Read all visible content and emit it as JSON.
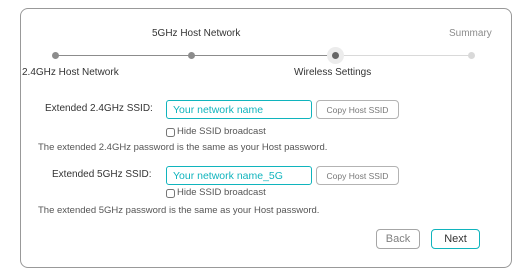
{
  "steps": [
    {
      "label": "2.4GHz Host Network",
      "state": "done"
    },
    {
      "label": "5GHz Host Network",
      "state": "done"
    },
    {
      "label": "Wireless Settings",
      "state": "current"
    },
    {
      "label": "Summary",
      "state": "pending"
    }
  ],
  "form": {
    "ssid_24": {
      "label": "Extended 2.4GHz SSID:",
      "placeholder": "Your network name",
      "value": "",
      "copy_label": "Copy Host SSID",
      "hide_label": "Hide SSID broadcast",
      "hide_checked": false,
      "note": "The extended 2.4GHz password is the same as your Host password."
    },
    "ssid_5": {
      "label": "Extended 5GHz SSID:",
      "placeholder": "Your network name_5G",
      "value": "",
      "copy_label": "Copy Host SSID",
      "hide_label": "Hide SSID broadcast",
      "hide_checked": false,
      "note": "The extended 5GHz password is the same as your Host password."
    }
  },
  "buttons": {
    "back": "Back",
    "next": "Next"
  },
  "colors": {
    "accent": "#10b4bd",
    "step_done": "#8c8c8c",
    "step_pending": "#d9d9d9",
    "card_border": "#999999"
  }
}
